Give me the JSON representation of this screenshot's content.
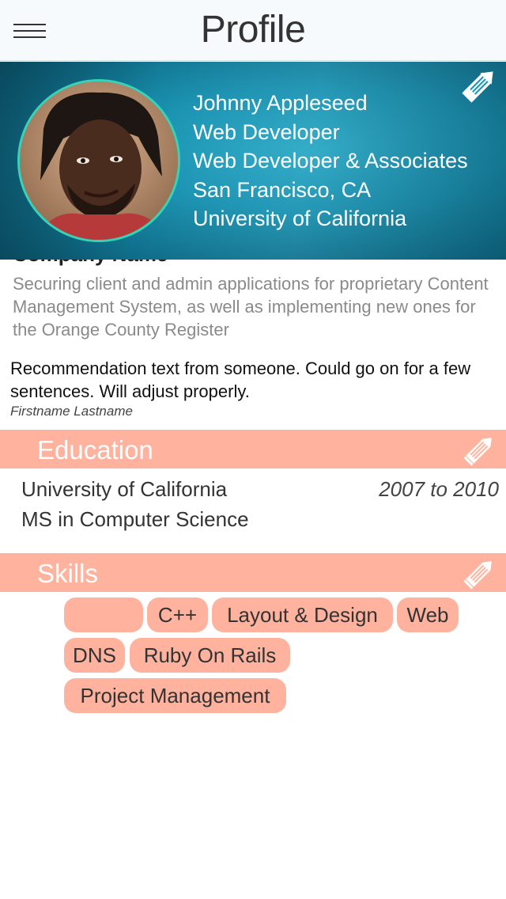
{
  "navbar": {
    "title": "Profile",
    "menu_icon": "hamburger-menu-icon"
  },
  "profile": {
    "name": "Johnny Appleseed",
    "title": "Web Developer",
    "company": "Web Developer & Associates",
    "location": "San Francisco, CA",
    "school": "University of California",
    "edit_icon": "pencil-icon"
  },
  "experience": {
    "company_name": "Company Name",
    "description": "Securing client and admin applications for proprietary Content Management System, as well as implementing new ones for the Orange County Register",
    "recommendation": "Recommendation text from someone.  Could go on for a few sentences.  Will adjust properly.",
    "recommender": "Firstname Lastname"
  },
  "education": {
    "heading": "Education",
    "school": "University of California",
    "dates": "2007 to 2010",
    "degree": "MS in Computer Science",
    "edit_icon": "pencil-icon"
  },
  "skills": {
    "heading": "Skills",
    "edit_icon": "pencil-icon",
    "items": [
      "",
      "C++",
      "Layout & Design",
      "Web",
      "DNS",
      "Ruby On Rails",
      "Project Management"
    ]
  },
  "colors": {
    "accent": "#ffb29d",
    "hero": "#1a93b2",
    "avatar_ring": "#35d3b8"
  }
}
